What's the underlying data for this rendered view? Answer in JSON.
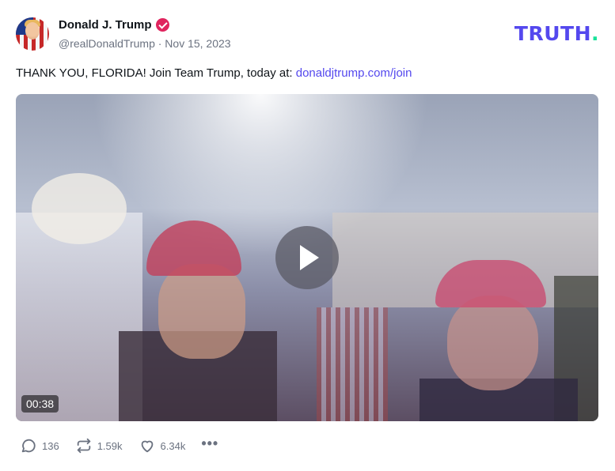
{
  "post": {
    "author_name": "Donald J. Trump",
    "handle_line": "@realDonaldTrump · Nov 15, 2023",
    "text_prefix": "THANK YOU, FLORIDA! Join Team Trump, today at: ",
    "link_text": "donaldjtrump.com/join",
    "video_duration": "00:38"
  },
  "brand": {
    "logo_main": "TRUTH",
    "logo_dot": "."
  },
  "actions": {
    "replies": "136",
    "retruths": "1.59k",
    "likes": "6.34k",
    "more": "•••"
  },
  "colors": {
    "brand_purple": "#5448ee",
    "brand_green": "#18e299",
    "verified_red": "#e0245e",
    "muted": "#6b7280"
  },
  "icons": [
    "verified-badge-icon",
    "reply-icon",
    "retruth-icon",
    "heart-icon",
    "more-icon",
    "play-icon"
  ]
}
